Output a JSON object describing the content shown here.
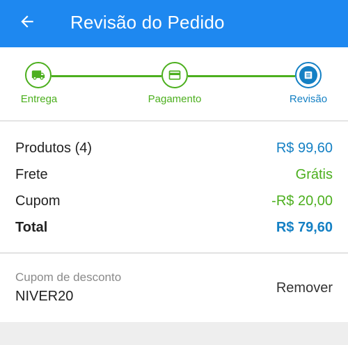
{
  "colors": {
    "app_bar": "#1e88f0",
    "accent_blue": "#1480c4",
    "accent_green": "#4caf1e"
  },
  "header": {
    "back_icon": "arrow-left-icon",
    "title": "Revisão do Pedido"
  },
  "stepper": {
    "steps": [
      {
        "label": "Entrega",
        "icon": "truck-icon",
        "state": "completed"
      },
      {
        "label": "Pagamento",
        "icon": "credit-card-icon",
        "state": "completed"
      },
      {
        "label": "Revisão",
        "icon": "list-document-icon",
        "state": "current"
      }
    ]
  },
  "summary": {
    "products_label": "Produtos (4)",
    "products_value": "R$ 99,60",
    "shipping_label": "Frete",
    "shipping_value": "Grátis",
    "coupon_label": "Cupom",
    "coupon_value": "-R$ 20,00",
    "total_label": "Total",
    "total_value": "R$ 79,60"
  },
  "coupon": {
    "caption": "Cupom de desconto",
    "code": "NIVER20",
    "remove_label": "Remover"
  }
}
